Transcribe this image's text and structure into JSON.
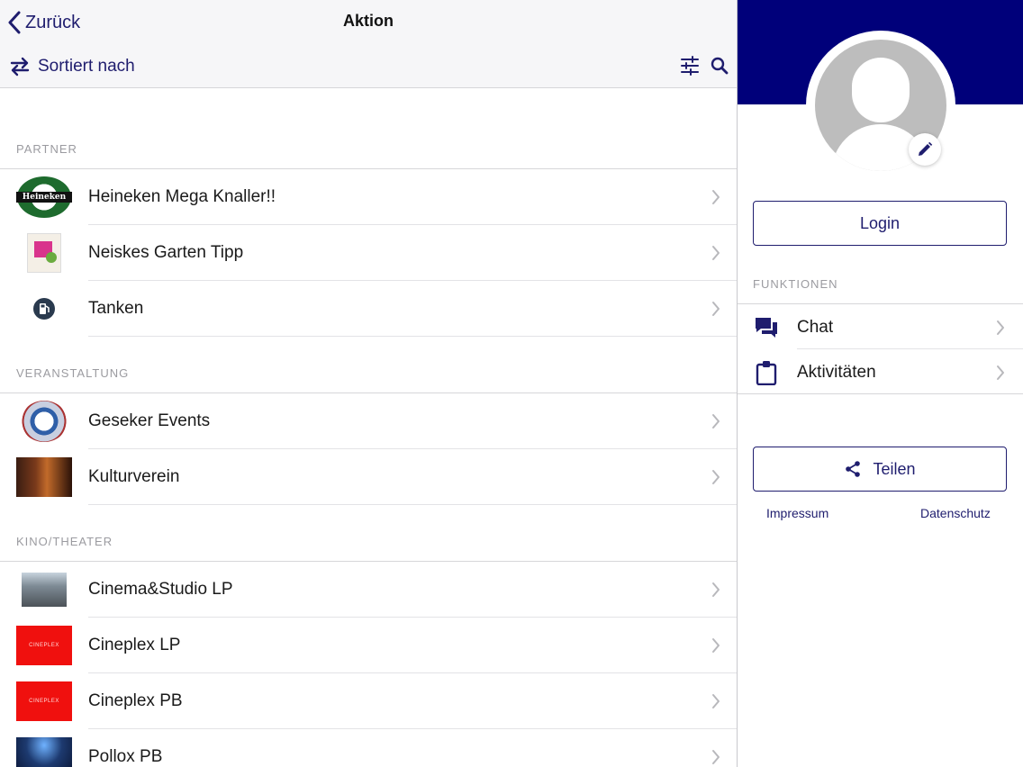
{
  "colors": {
    "accent": "#1f1d6e",
    "banner": "#00007a",
    "separator": "#d6d6d9",
    "section_text": "#9b9ba0"
  },
  "navbar": {
    "back_label": "Zurück",
    "back_icon": "chevron-left-icon",
    "title": "Aktion",
    "sort_label": "Sortiert nach",
    "sort_icon": "swap-arrows-icon",
    "filter_icon": "sliders-icon",
    "search_icon": "search-icon"
  },
  "sections": [
    {
      "header": "PARTNER",
      "items": [
        {
          "label": "Heineken Mega Knaller!!",
          "thumb_text": "Heineken"
        },
        {
          "label": "Neiskes Garten Tipp"
        },
        {
          "label": "Tanken"
        }
      ]
    },
    {
      "header": "VERANSTALTUNG",
      "items": [
        {
          "label": "Geseker Events"
        },
        {
          "label": "Kulturverein"
        }
      ]
    },
    {
      "header": "KINO/THEATER",
      "items": [
        {
          "label": "Cinema&Studio LP"
        },
        {
          "label": "Cineplex LP",
          "thumb_text": "CINEPLEX"
        },
        {
          "label": "Cineplex PB",
          "thumb_text": "CINEPLEX"
        },
        {
          "label": "Pollox PB"
        }
      ]
    }
  ],
  "sidebar": {
    "login_label": "Login",
    "functions_header": "FUNKTIONEN",
    "items": [
      {
        "label": "Chat",
        "icon": "chat-icon"
      },
      {
        "label": "Aktivitäten",
        "icon": "clipboard-icon"
      }
    ],
    "share_label": "Teilen",
    "share_icon": "share-icon",
    "imprint_label": "Impressum",
    "privacy_label": "Datenschutz"
  }
}
